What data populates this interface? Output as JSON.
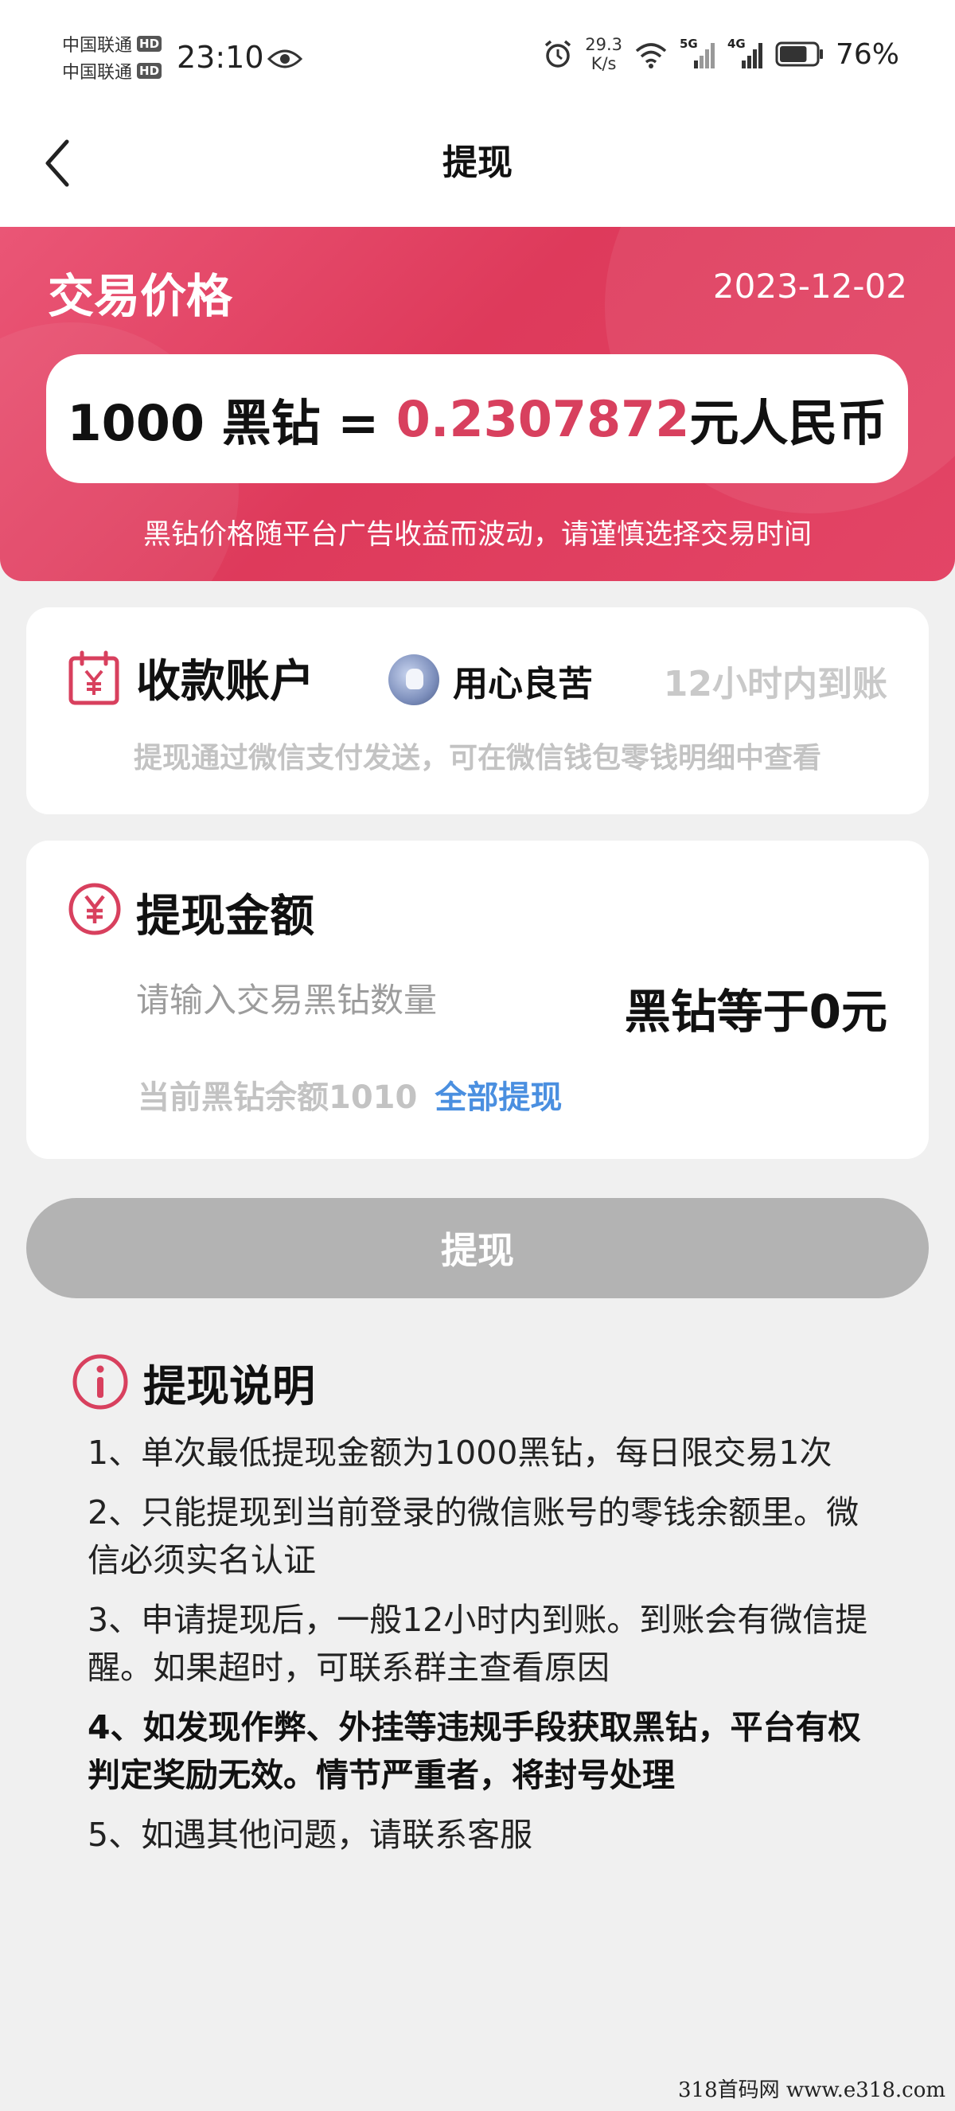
{
  "status_bar": {
    "carrier1": "中国联通",
    "carrier2": "中国联通",
    "hd_badge": "HD",
    "time": "23:10",
    "net_speed_value": "29.3",
    "net_speed_unit": "K/s",
    "sig1_label": "5G",
    "sig2_label": "4G",
    "battery_percent": "76%",
    "battery_level": 0.76
  },
  "nav": {
    "title": "提现"
  },
  "price_banner": {
    "title": "交易价格",
    "date": "2023-12-02",
    "price_left": "1000 黑钻 = ",
    "price_value": "0.2307872",
    "price_unit": "元人民币",
    "note": "黑钻价格随平台广告收益而波动，请谨慎选择交易时间"
  },
  "account_card": {
    "title": "收款账户",
    "user_name": "用心良苦",
    "eta": "12小时内到账",
    "note": "提现通过微信支付发送，可在微信钱包零钱明细中查看"
  },
  "amount_card": {
    "title": "提现金额",
    "input_placeholder": "请输入交易黑钻数量",
    "input_value": "",
    "equals_text": "黑钻等于0元",
    "balance_text": "当前黑钻余额1010",
    "withdraw_all_label": "全部提现"
  },
  "submit_label": "提现",
  "instructions": {
    "title": "提现说明",
    "rules": [
      "1、单次最低提现金额为1000黑钻，每日限交易1次",
      "2、只能提现到当前登录的微信账号的零钱余额里。微信必须实名认证",
      "3、申请提现后，一般12小时内到账。到账会有微信提醒。如果超时，可联系群主查看原因",
      "4、如发现作弊、外挂等违规手段获取黑钻，平台有权判定奖励无效。情节严重者，将封号处理",
      "5、如遇其他问题，请联系客服"
    ]
  },
  "watermark": "318首码网  www.e318.com",
  "colors": {
    "accent_red": "#d8405e",
    "link_blue": "#4a8fe0",
    "button_disabled": "#b3b3b3"
  }
}
